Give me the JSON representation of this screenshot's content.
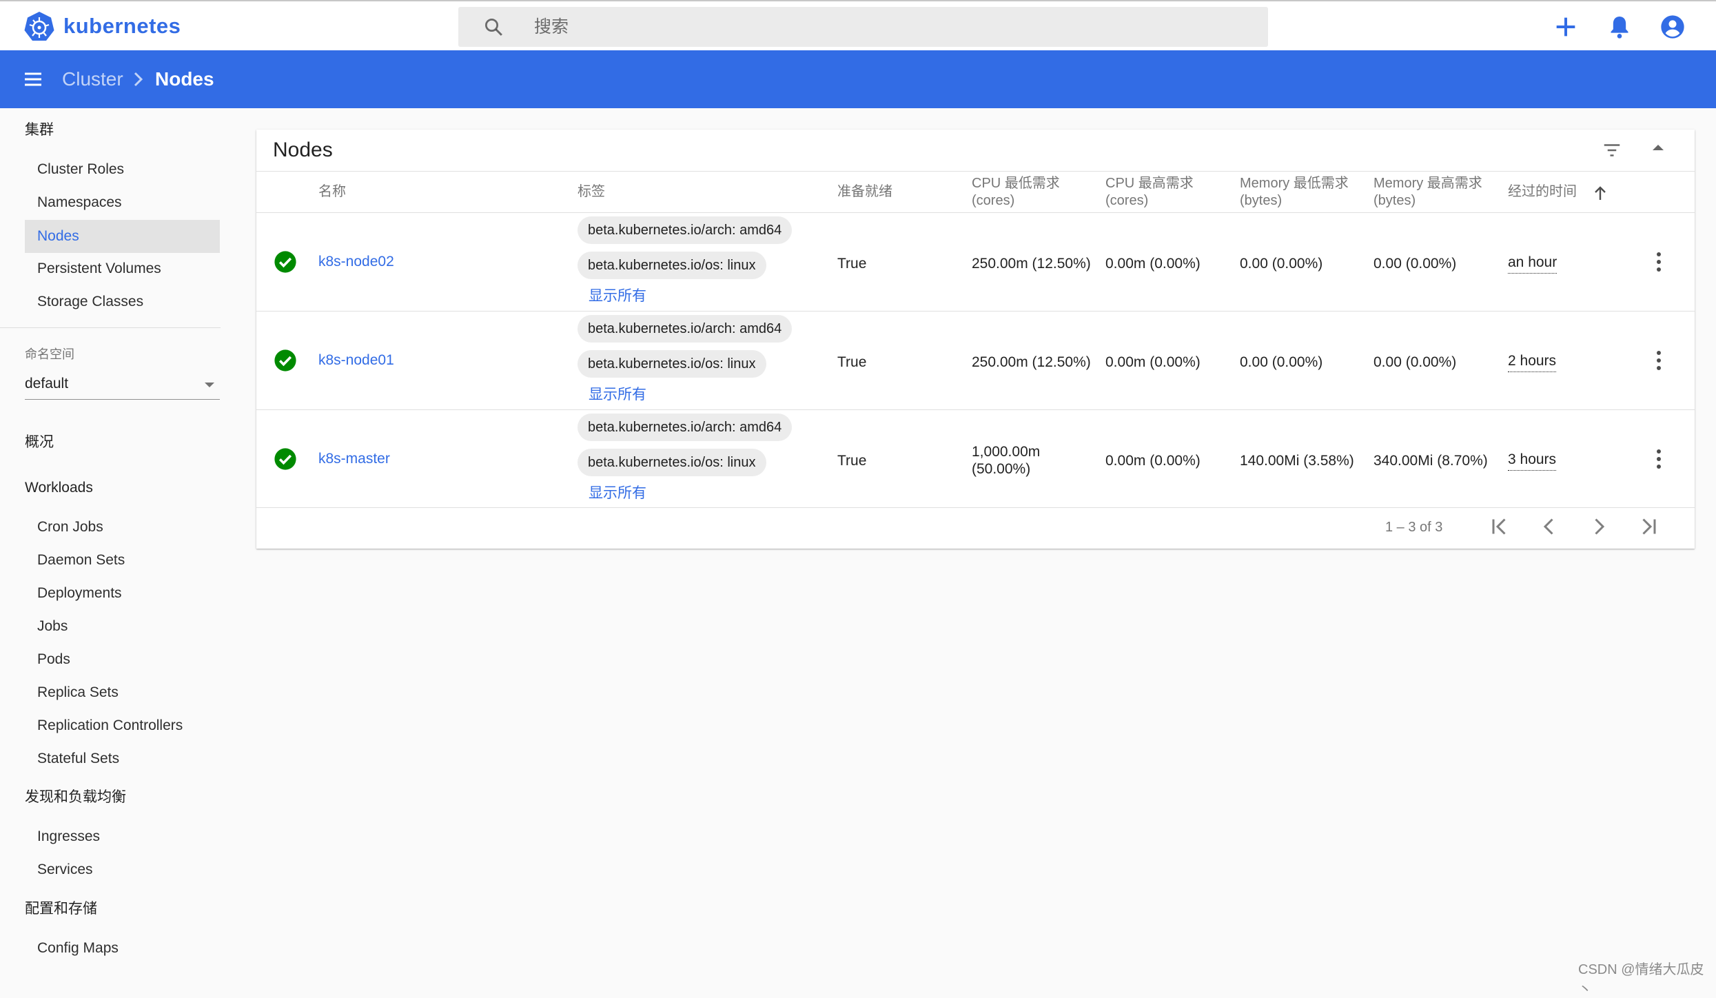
{
  "app": {
    "brand": "kubernetes"
  },
  "search": {
    "placeholder": "搜索"
  },
  "header": {
    "breadcrumb": [
      "Cluster",
      "Nodes"
    ],
    "menu_icon": "menu-icon",
    "actions": [
      "plus-icon",
      "bell-icon",
      "account-circle-icon"
    ]
  },
  "sidebar": {
    "cluster_heading": "集群",
    "cluster_items": [
      "Cluster Roles",
      "Namespaces",
      "Nodes",
      "Persistent Volumes",
      "Storage Classes"
    ],
    "active_item": "Nodes",
    "namespace_label": "命名空间",
    "namespace_value": "default",
    "overview": "概况",
    "workloads_heading": "Workloads",
    "workloads_items": [
      "Cron Jobs",
      "Daemon Sets",
      "Deployments",
      "Jobs",
      "Pods",
      "Replica Sets",
      "Replication Controllers",
      "Stateful Sets"
    ],
    "discovery_heading": "发现和负载均衡",
    "discovery_items": [
      "Ingresses",
      "Services"
    ],
    "config_heading": "配置和存储",
    "config_items": [
      "Config Maps"
    ]
  },
  "card": {
    "title": "Nodes",
    "columns": {
      "name": "名称",
      "labels": "标签",
      "ready": "准备就绪",
      "cpu_req_1": "CPU 最低需求",
      "cpu_req_2": "(cores)",
      "cpu_lim_1": "CPU 最高需求",
      "cpu_lim_2": "(cores)",
      "mem_req_1": "Memory 最低需求",
      "mem_req_2": "(bytes)",
      "mem_lim_1": "Memory 最高需求",
      "mem_lim_2": "(bytes)",
      "age": "经过的时间"
    },
    "rows": [
      {
        "status": "ready",
        "name": "k8s-node02",
        "label_arch": "beta.kubernetes.io/arch: amd64",
        "label_os": "beta.kubernetes.io/os: linux",
        "show_all": "显示所有",
        "ready": "True",
        "cpu_req": "250.00m (12.50%)",
        "cpu_lim": "0.00m (0.00%)",
        "mem_req": "0.00 (0.00%)",
        "mem_lim": "0.00 (0.00%)",
        "age": "an hour"
      },
      {
        "status": "ready",
        "name": "k8s-node01",
        "label_arch": "beta.kubernetes.io/arch: amd64",
        "label_os": "beta.kubernetes.io/os: linux",
        "show_all": "显示所有",
        "ready": "True",
        "cpu_req": "250.00m (12.50%)",
        "cpu_lim": "0.00m (0.00%)",
        "mem_req": "0.00 (0.00%)",
        "mem_lim": "0.00 (0.00%)",
        "age": "2 hours"
      },
      {
        "status": "ready",
        "name": "k8s-master",
        "label_arch": "beta.kubernetes.io/arch: amd64",
        "label_os": "beta.kubernetes.io/os: linux",
        "show_all": "显示所有",
        "ready": "True",
        "cpu_req_1": "1,000.00m",
        "cpu_req_2": "(50.00%)",
        "cpu_lim": "0.00m (0.00%)",
        "mem_req": "140.00Mi (3.58%)",
        "mem_lim": "340.00Mi (8.70%)",
        "age": "3 hours"
      }
    ],
    "pagination": "1 – 3 of 3"
  },
  "colors": {
    "brand": "#326ce5",
    "ready": "#008a00"
  },
  "watermark": "CSDN @情绪大瓜皮丶"
}
